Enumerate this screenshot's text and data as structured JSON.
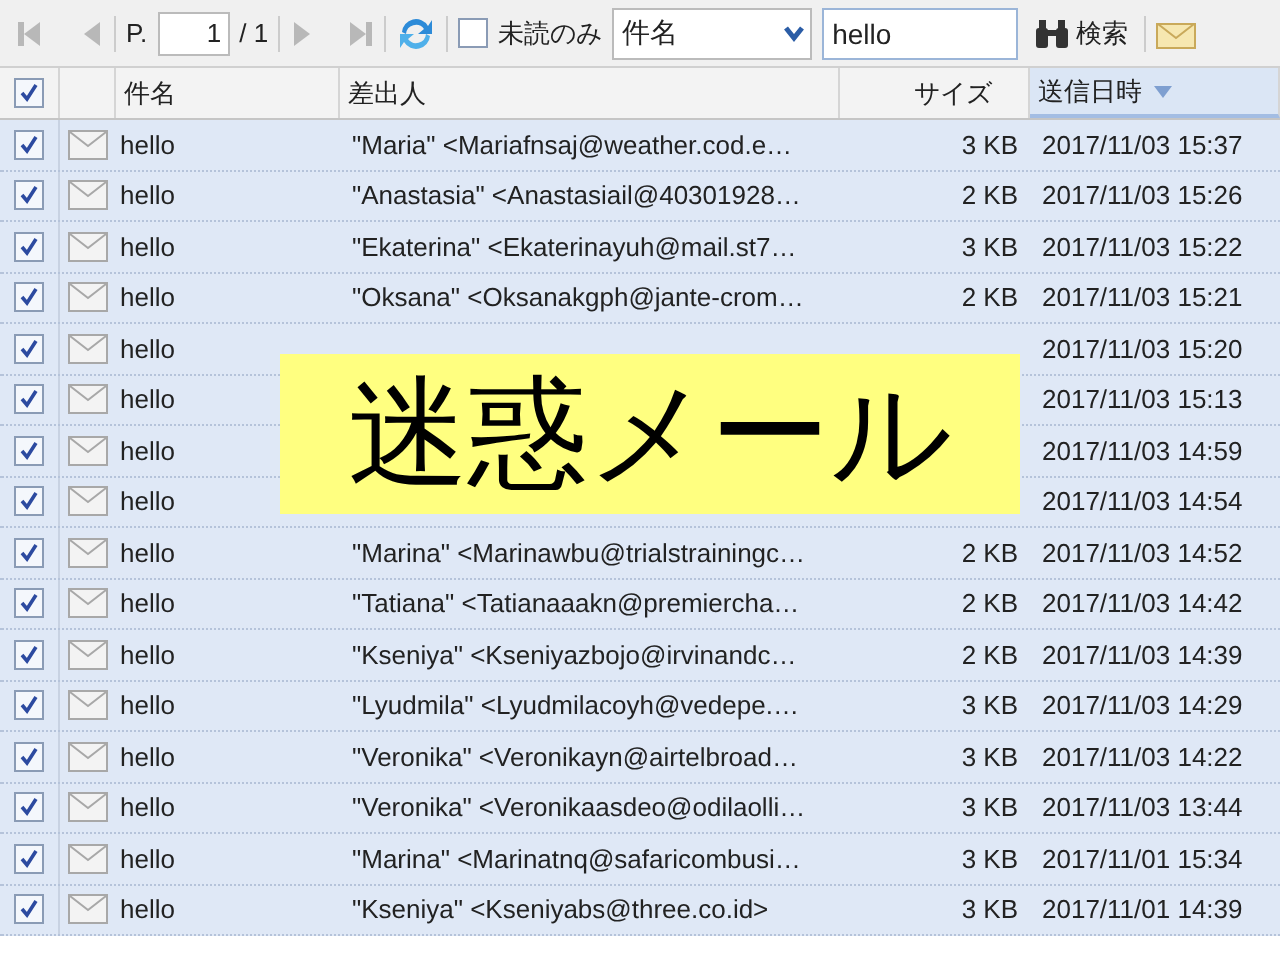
{
  "toolbar": {
    "page_label": "P.",
    "page": "1",
    "page_total": "/ 1",
    "unread_only": {
      "label": "未読のみ",
      "checked": false
    },
    "search_field": {
      "value": "件名"
    },
    "search_text": "hello",
    "search_button": "検索"
  },
  "table": {
    "select_all": {
      "checked": true
    },
    "columns": [
      {
        "label": "件名",
        "sorted": false
      },
      {
        "label": "差出人",
        "sorted": false
      },
      {
        "label": "サイズ",
        "sorted": false
      },
      {
        "label": "送信日時",
        "sorted": true
      }
    ],
    "rows": [
      {
        "checked": true,
        "subject": "hello",
        "sender": "\"Maria\" <Mariafnsaj@weather.cod.e…",
        "size": "3 KB",
        "date": "2017/11/03 15:37"
      },
      {
        "checked": true,
        "subject": "hello",
        "sender": "\"Anastasia\" <Anastasiail@40301928…",
        "size": "2 KB",
        "date": "2017/11/03 15:26"
      },
      {
        "checked": true,
        "subject": "hello",
        "sender": "\"Ekaterina\" <Ekaterinayuh@mail.st7…",
        "size": "3 KB",
        "date": "2017/11/03 15:22"
      },
      {
        "checked": true,
        "subject": "hello",
        "sender": "\"Oksana\" <Oksanakgph@jante-crom…",
        "size": "2 KB",
        "date": "2017/11/03 15:21"
      },
      {
        "checked": true,
        "subject": "hello",
        "date": "2017/11/03 15:20"
      },
      {
        "checked": true,
        "subject": "hello",
        "date": "2017/11/03 15:13"
      },
      {
        "checked": true,
        "subject": "hello",
        "date": "2017/11/03 14:59"
      },
      {
        "checked": true,
        "subject": "hello",
        "date": "2017/11/03 14:54"
      },
      {
        "checked": true,
        "subject": "hello",
        "sender": "\"Marina\" <Marinawbu@trialstrainingc…",
        "size": "2 KB",
        "date": "2017/11/03 14:52"
      },
      {
        "checked": true,
        "subject": "hello",
        "sender": "\"Tatiana\" <Tatianaaakn@premiercha…",
        "size": "2 KB",
        "date": "2017/11/03 14:42"
      },
      {
        "checked": true,
        "subject": "hello",
        "sender": "\"Kseniya\" <Kseniyazbojo@irvinandc…",
        "size": "2 KB",
        "date": "2017/11/03 14:39"
      },
      {
        "checked": true,
        "subject": "hello",
        "sender": "\"Lyudmila\" <Lyudmilacoyh@vedepe.…",
        "size": "3 KB",
        "date": "2017/11/03 14:29"
      },
      {
        "checked": true,
        "subject": "hello",
        "sender": "\"Veronika\" <Veronikayn@airtelbroad…",
        "size": "3 KB",
        "date": "2017/11/03 14:22"
      },
      {
        "checked": true,
        "subject": "hello",
        "sender": "\"Veronika\" <Veronikaasdeo@odilaolli…",
        "size": "3 KB",
        "date": "2017/11/03 13:44"
      },
      {
        "checked": true,
        "subject": "hello",
        "sender": "\"Marina\" <Marinatnq@safaricombusi…",
        "size": "3 KB",
        "date": "2017/11/01 15:34"
      },
      {
        "checked": true,
        "subject": "hello",
        "sender": "\"Kseniya\" <Kseniyabs@three.co.id>",
        "size": "3 KB",
        "date": "2017/11/01 14:39"
      }
    ]
  },
  "overlay": {
    "text": "迷惑メール"
  }
}
